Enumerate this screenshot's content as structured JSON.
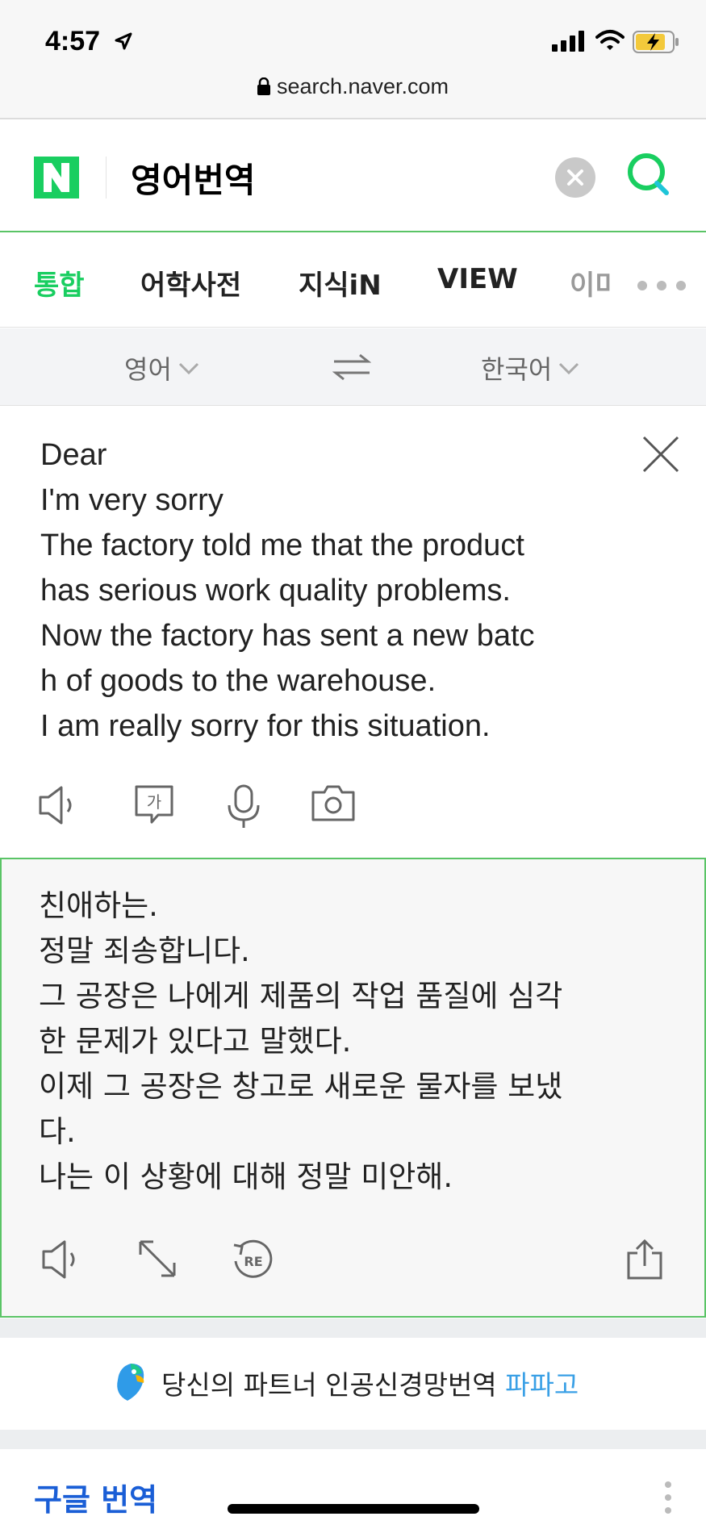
{
  "status_bar": {
    "time": "4:57",
    "url": "search.naver.com"
  },
  "search": {
    "query": "영어번역"
  },
  "tabs": [
    {
      "label": "통합",
      "active": true
    },
    {
      "label": "어학사전"
    },
    {
      "label": "지식iN"
    },
    {
      "label": "VIEW"
    },
    {
      "label": "이미"
    }
  ],
  "translator": {
    "source_lang": "영어",
    "target_lang": "한국어",
    "source_lines": [
      "Dear",
      "I'm very sorry",
      "The factory told me that the product",
      "has serious work quality problems.",
      "Now the factory has sent a new batc",
      "h of goods to the warehouse.",
      "I am really sorry for this situation."
    ],
    "target_lines": [
      "친애하는.",
      "정말 죄송합니다.",
      "그 공장은 나에게 제품의 작업 품질에 심각",
      "한 문제가 있다고 말했다.",
      "이제 그 공장은 창고로 새로운 물자를 보냈",
      "다.",
      "나는 이 상황에 대해 정말 미안해."
    ],
    "source_tools": [
      "speaker-icon",
      "hanja-keyboard-icon",
      "microphone-icon",
      "camera-icon"
    ],
    "target_tools": [
      "speaker-icon",
      "expand-icon",
      "retranslate-icon",
      "share-icon"
    ]
  },
  "promo": {
    "text": "당신의 파트너 인공신경망번역 ",
    "link": "파파고"
  },
  "google": {
    "title_prefix": "구글 ",
    "title_main": "번역"
  },
  "colors": {
    "naver_green": "#19ce60",
    "border_green": "#5ac466",
    "papago_blue": "#3aa0e6",
    "google_blue": "#1a5ed6"
  }
}
